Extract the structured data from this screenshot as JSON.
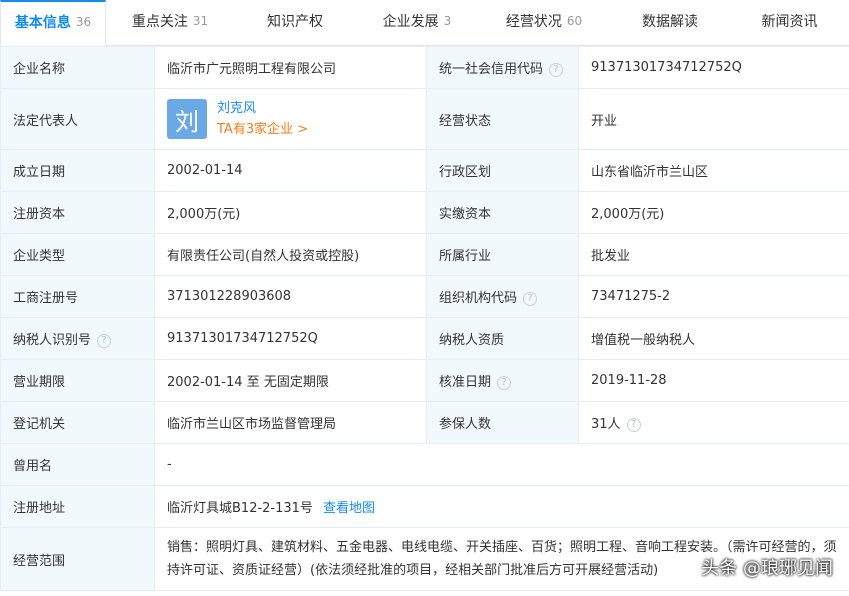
{
  "tabs": [
    {
      "label": "基本信息",
      "count": "36"
    },
    {
      "label": "重点关注",
      "count": "31"
    },
    {
      "label": "知识产权",
      "count": ""
    },
    {
      "label": "企业发展",
      "count": "3"
    },
    {
      "label": "经营状况",
      "count": "60"
    },
    {
      "label": "数据解读",
      "count": ""
    },
    {
      "label": "新闻资讯",
      "count": ""
    }
  ],
  "info": {
    "company_name": {
      "label": "企业名称",
      "value": "临沂市广元照明工程有限公司"
    },
    "credit_code": {
      "label": "统一社会信用代码",
      "value": "91371301734712752Q"
    },
    "legal_rep": {
      "label": "法定代表人",
      "avatar_char": "刘",
      "name": "刘克风",
      "companies": "TA有3家企业 >"
    },
    "status": {
      "label": "经营状态",
      "value": "开业"
    },
    "established": {
      "label": "成立日期",
      "value": "2002-01-14"
    },
    "region": {
      "label": "行政区划",
      "value": "山东省临沂市兰山区"
    },
    "reg_capital": {
      "label": "注册资本",
      "value": "2,000万(元)"
    },
    "paid_capital": {
      "label": "实缴资本",
      "value": "2,000万(元)"
    },
    "company_type": {
      "label": "企业类型",
      "value": "有限责任公司(自然人投资或控股)"
    },
    "industry": {
      "label": "所属行业",
      "value": "批发业"
    },
    "reg_number": {
      "label": "工商注册号",
      "value": "371301228903608"
    },
    "org_code": {
      "label": "组织机构代码",
      "value": "73471275-2"
    },
    "taxpayer_id": {
      "label": "纳税人识别号",
      "value": "91371301734712752Q"
    },
    "taxpayer_qual": {
      "label": "纳税人资质",
      "value": "增值税一般纳税人"
    },
    "term": {
      "label": "营业期限",
      "value": "2002-01-14 至 无固定期限"
    },
    "approval_date": {
      "label": "核准日期",
      "value": "2019-11-28"
    },
    "authority": {
      "label": "登记机关",
      "value": "临沂市兰山区市场监督管理局"
    },
    "insured": {
      "label": "参保人数",
      "value": "31人"
    },
    "former_name": {
      "label": "曾用名",
      "value": "-"
    },
    "address": {
      "label": "注册地址",
      "value": "临沂灯具城B12-2-131号",
      "map_link": "查看地图"
    },
    "scope": {
      "label": "经营范围",
      "value": "销售：照明灯具、建筑材料、五金电器、电线电缆、开关插座、百货；照明工程、音响工程安装。（需许可经营的，须持许可证、资质证经营）(依法须经批准的项目，经相关部门批准后方可开展经营活动)"
    }
  },
  "help_glyph": "?",
  "watermark": "头条 @琅琊见闻"
}
